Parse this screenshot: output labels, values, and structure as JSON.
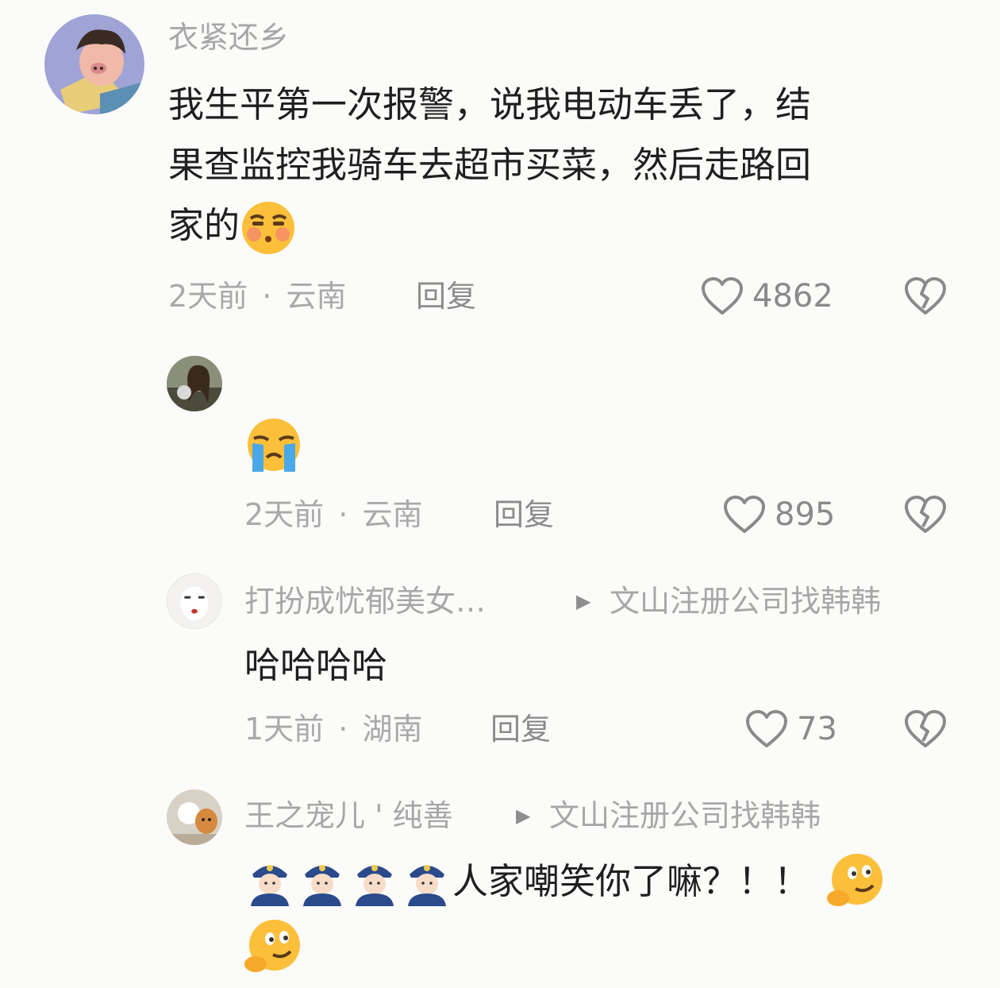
{
  "comments": [
    {
      "username": "衣紧还乡",
      "text_lines": [
        "我生平第一次报警，说我电动车丢了，结",
        "果查监控我骑车去超市买菜，然后走路回",
        "家的"
      ],
      "emoji": "smirk-blush-emoji",
      "time": "2天前",
      "location": "云南",
      "reply_label": "回复",
      "likes": "4862"
    },
    {
      "username": "",
      "emoji": "crying-face-emoji",
      "time": "2天前",
      "location": "云南",
      "reply_label": "回复",
      "likes": "895"
    },
    {
      "username": "打扮成忧郁美女…",
      "reply_to": "文山注册公司找韩韩",
      "text": "哈哈哈哈",
      "time": "1天前",
      "location": "湖南",
      "reply_label": "回复",
      "likes": "73"
    },
    {
      "username": "王之宠儿 ' 纯善",
      "reply_to": "文山注册公司找韩韩",
      "text": "人家嘲笑你了嘛？！！",
      "emojis_before": [
        "police-officer-emoji",
        "police-officer-emoji",
        "police-officer-emoji",
        "police-officer-emoji"
      ],
      "emojis_after": [
        "thinking-smirk-emoji",
        "thinking-smirk-emoji"
      ]
    }
  ],
  "separator": "·",
  "colors": {
    "background": "#fbfbf9",
    "text_primary": "#1f1f1f",
    "text_secondary": "#a7a7a7",
    "icon": "#8a8a8a"
  }
}
